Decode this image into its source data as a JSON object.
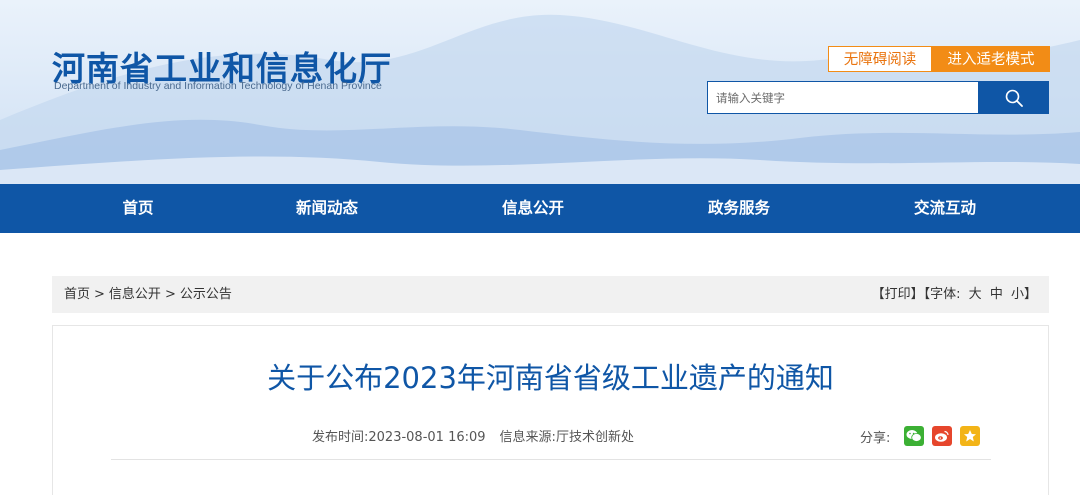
{
  "header": {
    "title": "河南省工业和信息化厅",
    "subtitle": "Department of Industry and Information Technology of Henan Province",
    "accessible_btn": "无障碍阅读",
    "elderly_btn": "进入适老模式",
    "search": {
      "placeholder": "请输入关键字",
      "icon": "search-icon"
    }
  },
  "nav": {
    "items": [
      {
        "label": "首页"
      },
      {
        "label": "新闻动态"
      },
      {
        "label": "信息公开"
      },
      {
        "label": "政务服务"
      },
      {
        "label": "交流互动"
      }
    ]
  },
  "breadcrumb": {
    "items": [
      {
        "label": "首页"
      },
      {
        "label": "信息公开"
      },
      {
        "label": "公示公告"
      }
    ],
    "separator": ">"
  },
  "tools": {
    "print": "【打印】",
    "font_prefix": "【字体:",
    "font_large": "大",
    "font_medium": "中",
    "font_small": "小",
    "font_suffix": "】"
  },
  "article": {
    "title": "关于公布2023年河南省省级工业遗产的通知",
    "publish_label": "发布时间:",
    "publish_time": "2023-08-01 16:09",
    "source_label": "信息来源:",
    "source": "厅技术创新处",
    "share_label": "分享:"
  },
  "colors": {
    "brand_blue": "#0f56a6",
    "accent_orange": "#f28c16",
    "wechat_green": "#3cb034",
    "weibo_red": "#e6462c",
    "qzone_yellow": "#f3b417"
  }
}
